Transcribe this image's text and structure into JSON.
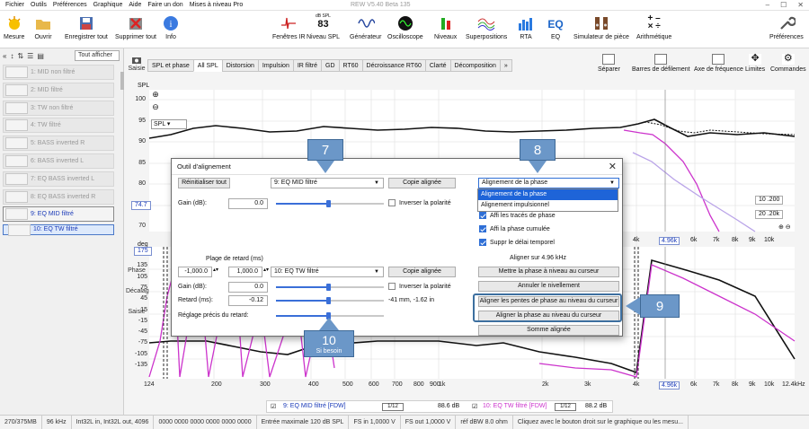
{
  "window": {
    "title": "REW V5.40 Beta 135",
    "menu": [
      "Fichier",
      "Outils",
      "Préférences",
      "Graphique",
      "Aide",
      "Faire un don",
      "Mises à niveau Pro"
    ]
  },
  "toolbar": {
    "left": [
      "Mesure",
      "Ouvrir",
      "Enregistrer tout",
      "Supprimer tout",
      "Info"
    ],
    "center": [
      "Fenêtres IR",
      "Niveau SPL",
      "Générateur",
      "Oscilloscope",
      "Niveaux",
      "Superpositions",
      "RTA",
      "EQ",
      "Simulateur de pièce",
      "Arithmétique"
    ],
    "spl_value": "83",
    "spl_unit": "dB SPL",
    "prefs": "Préférences"
  },
  "left_panel": {
    "dropdown": "Tout afficher",
    "measurements": [
      {
        "label": "1: MID non filtré",
        "state": "off"
      },
      {
        "label": "2: MID filtré",
        "state": "off"
      },
      {
        "label": "3: TW non filtré",
        "state": "off"
      },
      {
        "label": "4: TW filtré",
        "state": "off"
      },
      {
        "label": "5: BASS inverted R",
        "state": "off"
      },
      {
        "label": "6: BASS inverted L",
        "state": "off"
      },
      {
        "label": "7: EQ BASS inverted L",
        "state": "off"
      },
      {
        "label": "8: EQ BASS inverted R",
        "state": "off"
      },
      {
        "label": "9: EQ MID filtré",
        "state": "active"
      },
      {
        "label": "10: EQ TW filtré",
        "state": "sel"
      }
    ]
  },
  "graph": {
    "side_tools": [
      "Saisie",
      "Phase",
      "Décalage",
      "Saisie"
    ],
    "tabs": [
      "SPL et phase",
      "All SPL",
      "Distorsion",
      "Impulsion",
      "IR filtré",
      "GD",
      "RT60",
      "Décroissance RT60",
      "Clarté",
      "Décomposition",
      "»"
    ],
    "active_tab": "All SPL",
    "right_tools": [
      "Séparer",
      "Barres de défilement",
      "Axe de fréquence",
      "Limites",
      "Commandes"
    ],
    "spl_dropdown": "SPL",
    "top_axis_title": "SPL",
    "top_y_ticks": [
      "100",
      "95",
      "90",
      "85",
      "80",
      "75",
      "70"
    ],
    "bot_y_ticks": [
      "175",
      "150",
      "135",
      "105",
      "75",
      "45",
      "15",
      "-15",
      "-45",
      "-75",
      "-105",
      "-135"
    ],
    "x_ticks": [
      "124",
      "200",
      "300",
      "400",
      "500",
      "600",
      "700",
      "800",
      "900",
      "1k",
      "2k",
      "3k",
      "4k",
      "4.96k",
      "6k",
      "7k",
      "8k",
      "9k",
      "10k",
      "12.4kHz"
    ],
    "top_x_ticks": [
      "4k",
      "4.96k",
      "6k",
      "7k",
      "8k",
      "9k",
      "10k"
    ],
    "cursor_y_top": "74.7",
    "cursor_y_bot": "175",
    "box_top_right": "10 .200",
    "box_top_right2": "20 .20k",
    "phase_title": "deg"
  },
  "legend": {
    "a": {
      "label": "9: EQ MID filtré [FDW]",
      "value": "88.6 dB"
    },
    "b": {
      "label": "10: EQ TW filtré [FDW]",
      "value": "88.2 dB"
    },
    "smooth": "1/12"
  },
  "status": [
    "270/375MB",
    "96 kHz",
    "Int32L in, Int32L out, 4096",
    "0000 0000 0000 0000 0000 0000",
    "Entrée maximale 120 dB SPL",
    "FS in 1,0000 V",
    "FS out 1,0000 V",
    "réf dBW 8.0 ohm",
    "Cliquez avec le bouton droit sur le graphique ou les mesu..."
  ],
  "dialog": {
    "title": "Outil d'alignement",
    "reset": "Réinitialiser tout",
    "meas1": "9: EQ MID filtré",
    "copy1": "Copie alignée",
    "mode": "Alignement de la phase",
    "mode_options": [
      "Alignement de la phase",
      "Alignement impulsionnel"
    ],
    "gain_label": "Gain (dB):",
    "gain1": "0.0",
    "invert1": "Inverser la polarité",
    "show_phase": "Affi les tracés de phase",
    "cum_phase": "Affi la phase cumulée",
    "remove_delay": "Suppr le délai temporel",
    "delay_range_label": "Plage de retard (ms)",
    "range_min": "-1,000.0",
    "range_max": "1,000.0",
    "meas2": "10: EQ TW filtré",
    "copy2": "Copie alignée",
    "align_at": "Aligner sur 4.96 kHz",
    "btn_cursor_phase": "Mettre la phase à niveau au curseur",
    "btn_cancel": "Annuler le nivellement",
    "gain2": "0.0",
    "invert2": "Inverser la polarité",
    "delay_label": "Retard (ms):",
    "delay": "-0.12",
    "delay_info": "-41 mm, -1.62 in",
    "fine_label": "Réglage précis du retard:",
    "btn_align_slopes": "Aligner les pentes de phase au niveau du curseur",
    "btn_align_phase": "Aligner la phase au niveau du curseur",
    "btn_sum": "Somme alignée"
  },
  "callouts": {
    "c7": "7",
    "c8": "8",
    "c9": "9",
    "c10": "10",
    "c10_sub": "Si besoin"
  },
  "colors": {
    "accent": "#2f6fd6",
    "callout": "#6b97c8",
    "magenta": "#cc33cc",
    "violet": "#b9a3e8"
  }
}
